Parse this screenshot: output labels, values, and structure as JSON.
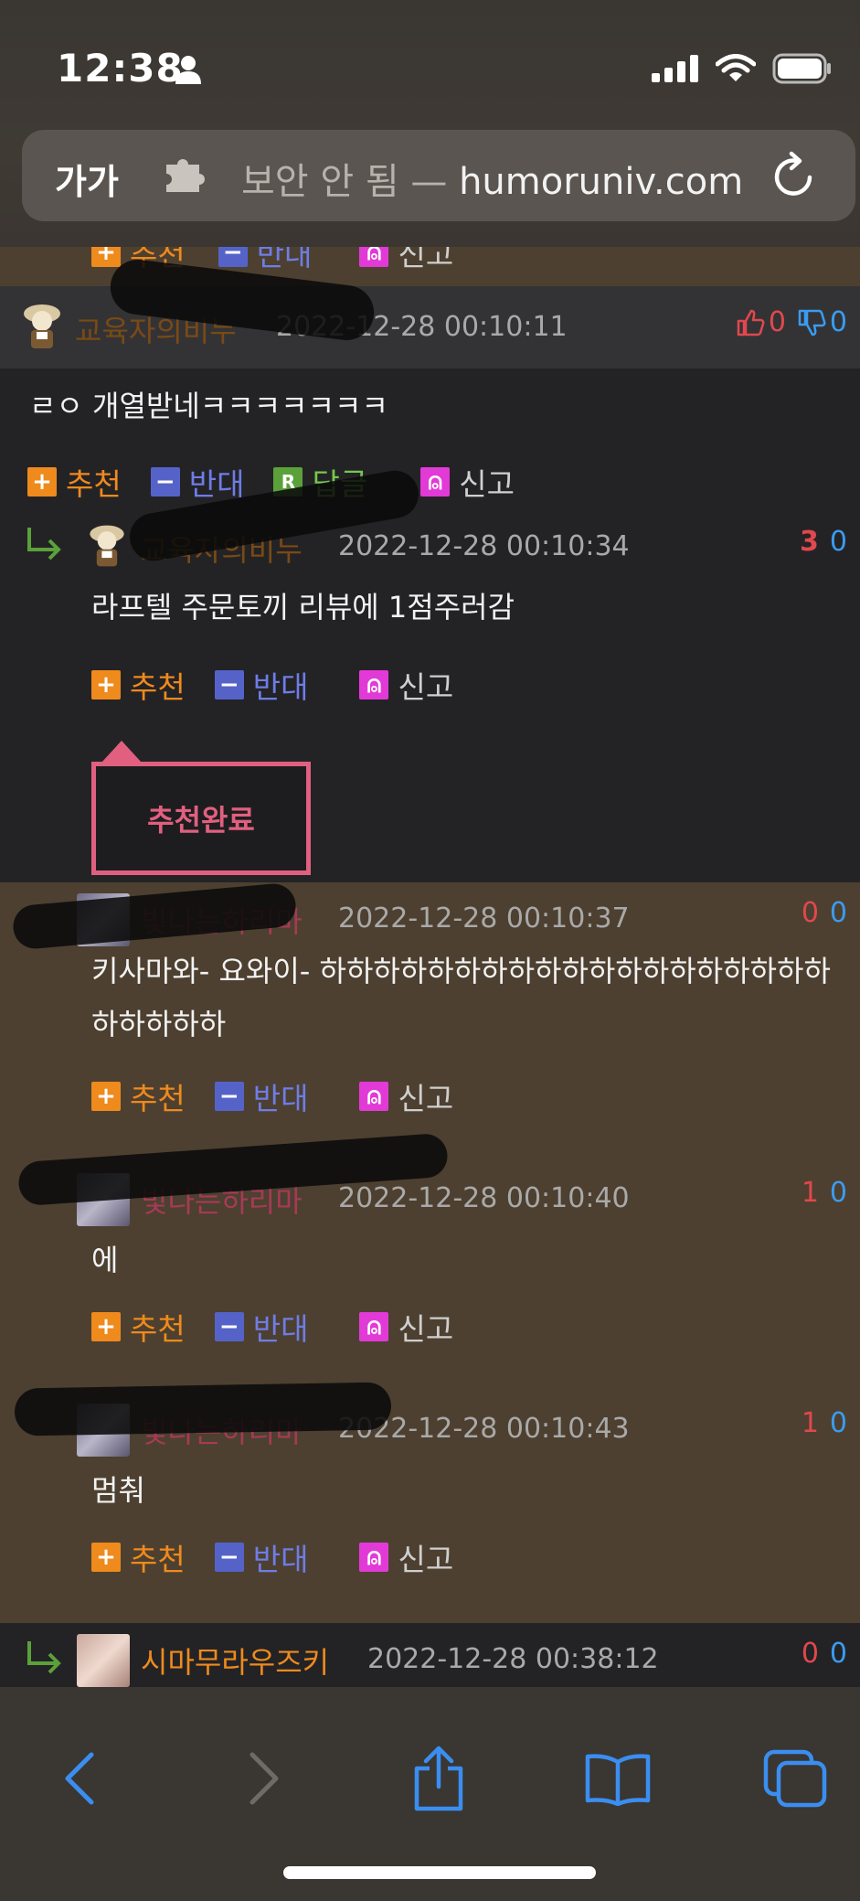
{
  "status_bar": {
    "time": "12:38"
  },
  "url_bar": {
    "text_size_label": "가가",
    "security_text": "보안 안 됨 —",
    "domain": "humoruniv.com"
  },
  "top_partial_actions": {
    "recommend": "추천",
    "oppose": "반대",
    "report": "신고"
  },
  "main_comment": {
    "nickname": "교육자의비누",
    "date": "2022-12-28 00:10:11",
    "up": "0",
    "down": "0",
    "text": "ㄹㅇ 개열받네ㅋㅋㅋㅋㅋㅋㅋ",
    "actions": {
      "recommend": "추천",
      "oppose": "반대",
      "reply": "답글",
      "report": "신고"
    }
  },
  "replies": [
    {
      "nickname": "교육자의비누",
      "date": "2022-12-28 00:10:34",
      "up": "3",
      "down": "0",
      "text": "라프텔 주문토끼 리뷰에 1점주러감",
      "actions": {
        "recommend": "추천",
        "oppose": "반대",
        "report": "신고"
      },
      "tooltip": "추천완료"
    },
    {
      "nickname": "빛나는하리마",
      "date": "2022-12-28 00:10:37",
      "up": "0",
      "down": "0",
      "text_line1": "키사마와- 요와이- 하하하하하하하하하하하하하하하하하하하",
      "text_line2": "하하하하하",
      "actions": {
        "recommend": "추천",
        "oppose": "반대",
        "report": "신고"
      }
    },
    {
      "nickname": "빛나는하리마",
      "date": "2022-12-28 00:10:40",
      "up": "1",
      "down": "0",
      "text": "에",
      "actions": {
        "recommend": "추천",
        "oppose": "반대",
        "report": "신고"
      }
    },
    {
      "nickname": "빛나는하리마",
      "date": "2022-12-28 00:10:43",
      "up": "1",
      "down": "0",
      "text": "멈춰",
      "actions": {
        "recommend": "추천",
        "oppose": "반대",
        "report": "신고"
      }
    },
    {
      "nickname": "시마무라우즈키",
      "date": "2022-12-28 00:38:12",
      "up": "0",
      "down": "0"
    }
  ],
  "colors": {
    "recommend": "#ef8a1d",
    "oppose": "#5563c9",
    "reply": "#5ba13a",
    "report": "#e23ad7",
    "up_vote": "#e0484d",
    "down_vote": "#3a9cf0",
    "tooltip": "#e1607f",
    "nick_edu": "#7a4a14",
    "nick_harima": "#a63a55",
    "nick_shima": "#ef8a1d"
  },
  "icons": [
    "person-icon",
    "signal-icon",
    "wifi-icon",
    "battery-icon",
    "extension-icon",
    "reload-icon",
    "thumbs-up-icon",
    "thumbs-down-icon",
    "reply-arrow-icon",
    "back-icon",
    "forward-icon",
    "share-icon",
    "bookmarks-icon",
    "tabs-icon"
  ]
}
